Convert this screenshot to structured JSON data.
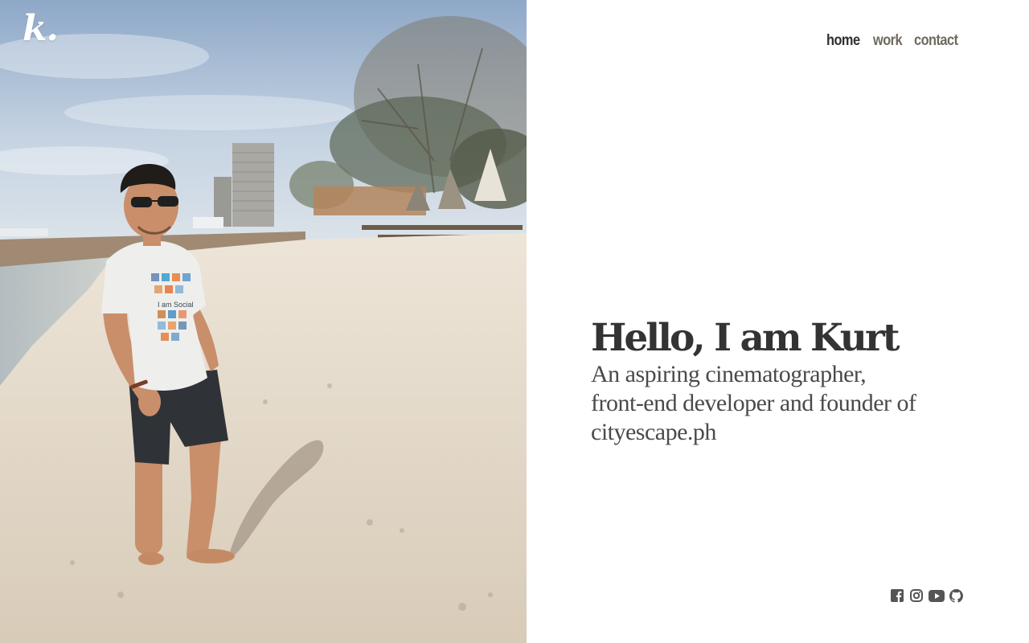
{
  "brand": {
    "logo_text": "k."
  },
  "nav": {
    "items": [
      {
        "label": "home",
        "active": true
      },
      {
        "label": "work",
        "active": false
      },
      {
        "label": "contact",
        "active": false
      }
    ]
  },
  "hero": {
    "heading": "Hello, I am Kurt",
    "tagline_lines": [
      "An aspiring cinematographer,",
      "front-end developer and founder of",
      "cityescape.ph"
    ]
  },
  "photo": {
    "subject": "man in white shirt walking on beach",
    "shirt_text": "I am Social"
  },
  "socials": [
    {
      "icon": "facebook-icon"
    },
    {
      "icon": "instagram-icon"
    },
    {
      "icon": "youtube-icon"
    },
    {
      "icon": "github-icon"
    }
  ],
  "colors": {
    "text_dark": "#333333",
    "nav_active": "#2f2f2f",
    "nav_inactive": "#6f6a5e",
    "icon": "#555555",
    "background": "#ffffff"
  }
}
